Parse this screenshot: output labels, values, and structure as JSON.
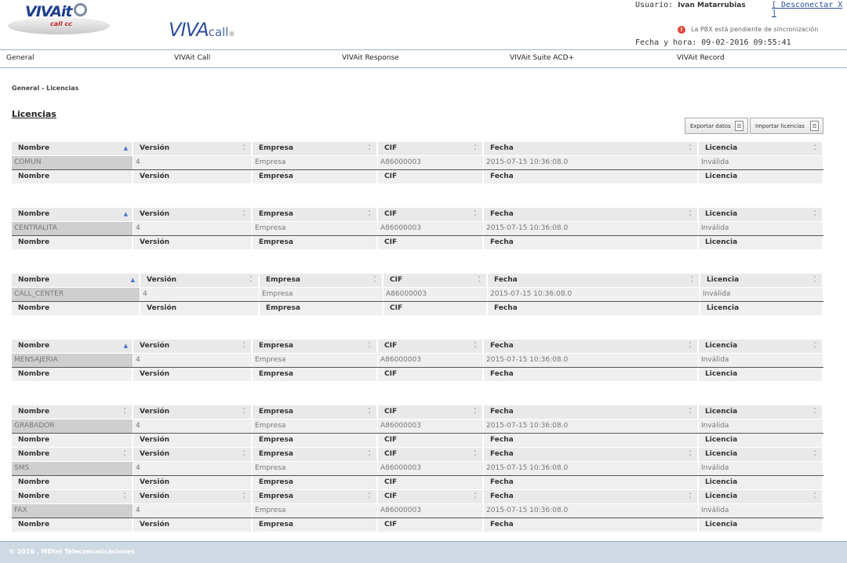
{
  "header": {
    "logo_text": "VIVAit",
    "logo_sub": "call cc",
    "product_name": "VIVA",
    "product_suffix": "call",
    "product_reg": "®",
    "user_label": "Usuario:",
    "user_name": "Ivan Matarrubias",
    "logout": "[ Desconectar X ]",
    "sync_warning": "La PBX está pendiente de sincronización",
    "datetime": "Fecha y hora: 09-02-2016 09:55:41"
  },
  "nav": [
    "General",
    "VIVAit Call",
    "VIVAit Response",
    "VIVAit Suite ACD+",
    "VIVAit Record"
  ],
  "breadcrumb": "General - Licencias",
  "page_title": "Licencias",
  "buttons": {
    "export": "Exportar datos",
    "import": "Importar licencias"
  },
  "columns": [
    "Nombre",
    "Versión",
    "Empresa",
    "CIF",
    "Fecha",
    "Licencia"
  ],
  "groups": [
    {
      "rows": [
        {
          "nombre": "COMUN",
          "version": "4",
          "empresa": "Empresa",
          "cif": "A86000003",
          "fecha": "2015-07-15 10:36:08.0",
          "licencia": "Inválida"
        }
      ]
    },
    {
      "rows": [
        {
          "nombre": "CENTRALITA",
          "version": "4",
          "empresa": "Empresa",
          "cif": "A86000003",
          "fecha": "2015-07-15 10:36:08.0",
          "licencia": "Inválida"
        }
      ]
    },
    {
      "rows": [
        {
          "nombre": "CALL_CENTER",
          "version": "4",
          "empresa": "Empresa",
          "cif": "A86000003",
          "fecha": "2015-07-15 10:36:08.0",
          "licencia": "Inválida"
        }
      ]
    },
    {
      "rows": [
        {
          "nombre": "MENSAJERIA",
          "version": "4",
          "empresa": "Empresa",
          "cif": "A86000003",
          "fecha": "2015-07-15 10:36:08.0",
          "licencia": "Inválida"
        }
      ]
    },
    {
      "rows": [
        {
          "nombre": "GRABADOR",
          "version": "4",
          "empresa": "Empresa",
          "cif": "A86000003",
          "fecha": "2015-07-15 10:36:08.0",
          "licencia": "Inválida"
        },
        {
          "nombre": "SMS",
          "version": "4",
          "empresa": "Empresa",
          "cif": "A86000003",
          "fecha": "2015-07-15 10:36:08.0",
          "licencia": "Inválida"
        },
        {
          "nombre": "FAX",
          "version": "4",
          "empresa": "Empresa",
          "cif": "A86000003",
          "fecha": "2015-07-15 10:36:08.0",
          "licencia": "Inválida"
        }
      ]
    }
  ],
  "footer": "© 2016 , MDtel Telecomunicaciones",
  "colors": {
    "brand": "#1d3f8a",
    "accent": "#2f4f9e",
    "header_bg": "#e9e9e9",
    "row_bg": "#efefef",
    "footer_bg": "#cfd9e4",
    "warning": "#e3463b"
  }
}
